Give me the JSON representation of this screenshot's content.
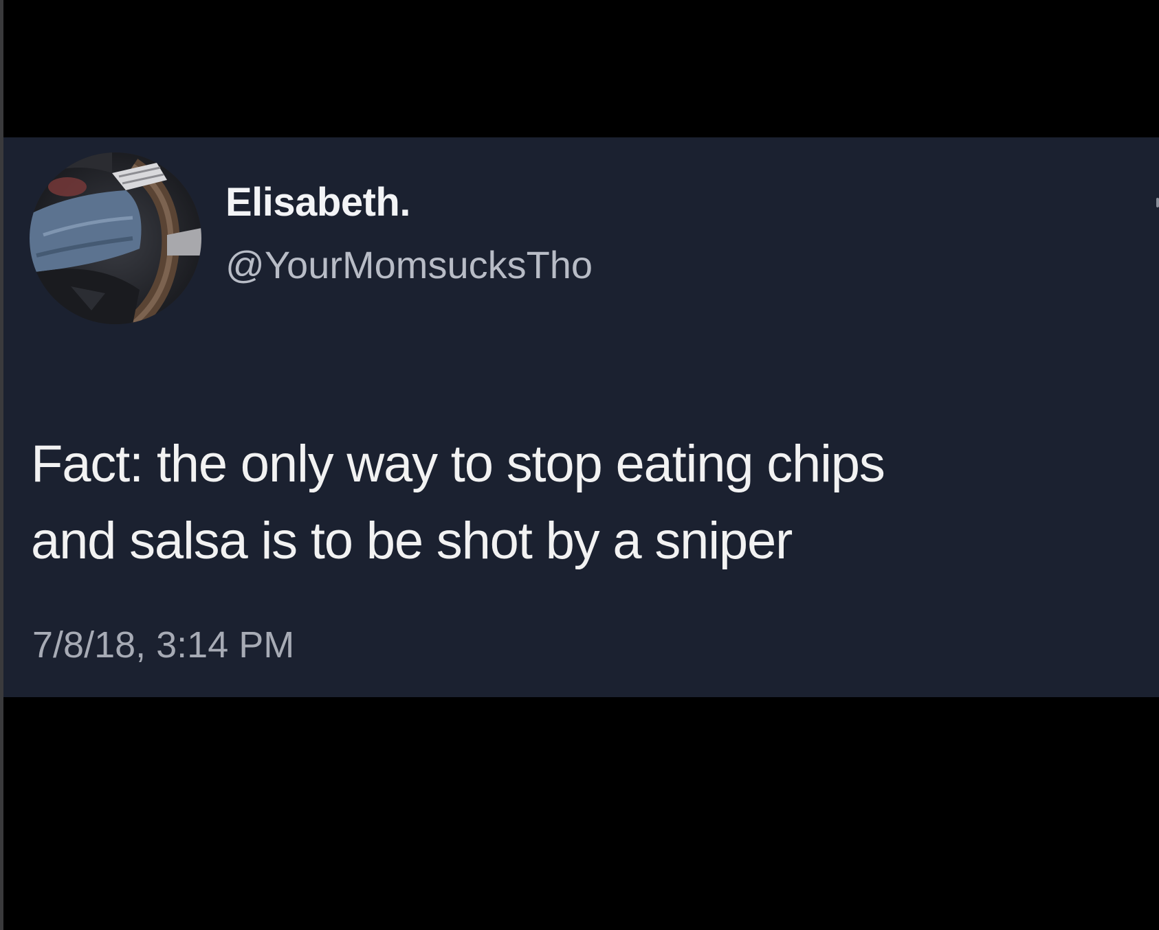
{
  "tweet": {
    "display_name": "Elisabeth.",
    "handle": "@YourMomsucksTho",
    "text_lines": [
      "Fact: the only way to stop eating chips",
      "and salsa is to be shot by a sniper"
    ],
    "timestamp": "7/8/18, 3:14 PM",
    "avatar_icon": "profile-photo-steering-wheel"
  },
  "colors": {
    "page_background": "#000000",
    "card_background": "#1b2130",
    "name_color": "#f3f4f6",
    "handle_color": "#b8bcc6",
    "text_color": "#f2f2f2",
    "timestamp_color": "#a7abb5"
  }
}
